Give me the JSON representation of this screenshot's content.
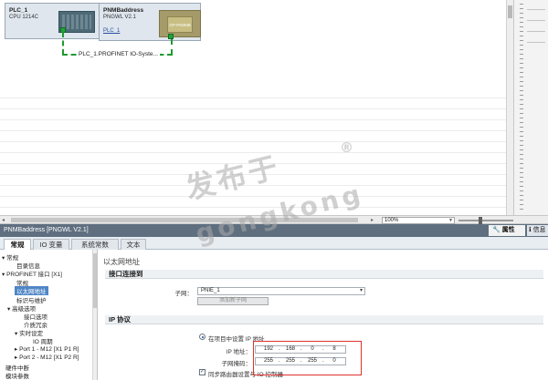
{
  "network_view": {
    "plc": {
      "name": "PLC_1",
      "type": "CPU 1214C"
    },
    "io_device": {
      "name": "PNMBaddress",
      "type": "PNGWL V2.1",
      "link": "PLC_1",
      "module_text": "GP-PN0MB"
    },
    "network_label": "PLC_1.PROFINET IO-Syste...",
    "zoom": "100%"
  },
  "inspector": {
    "title": "PNMBaddress [PNGWL V2.1]",
    "panel_tabs": {
      "properties": "属性",
      "info": "信息"
    },
    "tabs": [
      "常规",
      "IO 变量",
      "系统常数",
      "文本"
    ],
    "active_tab_index": 0
  },
  "nav": {
    "items": [
      "▾ 常规",
      "目录信息",
      "▾ PROFINET 接口 [X1]",
      "常规",
      "以太网地址",
      "标识与维护",
      "▾ 高级选项",
      "接口选项",
      "介质冗余",
      "▾ 实时设定",
      "IO 周期",
      "▸ Port 1 - M12 [X1 P1 R]",
      "▸ Port 2 - M12 [X1 P2 R]",
      "硬件中断",
      "模块参数"
    ],
    "selected_index": 4
  },
  "content": {
    "breadcrumb": "以太网地址",
    "interface_section": {
      "title": "接口连接到",
      "subnet_label": "子网：",
      "subnet_value": "PNIE_1",
      "add_button": "添加新子网"
    },
    "ip_section": {
      "title": "IP 协议",
      "radio_label": "在项目中设置 IP 地址",
      "ip_label": "IP 地址：",
      "ip": [
        "192",
        "168",
        "0",
        "8"
      ],
      "mask_label": "子网掩码：",
      "mask": [
        "255",
        "255",
        "255",
        "0"
      ],
      "sync_label": "同步路由器设置与 IO 控制器"
    }
  },
  "watermark": {
    "text_cn": "发布于",
    "text_en": "gongkong",
    "mark": "®"
  },
  "colors": {
    "title_bar": "#5f6f80",
    "selection": "#4f86c6",
    "network_line": "#1f9a2f",
    "highlight_box": "#e0302e"
  }
}
